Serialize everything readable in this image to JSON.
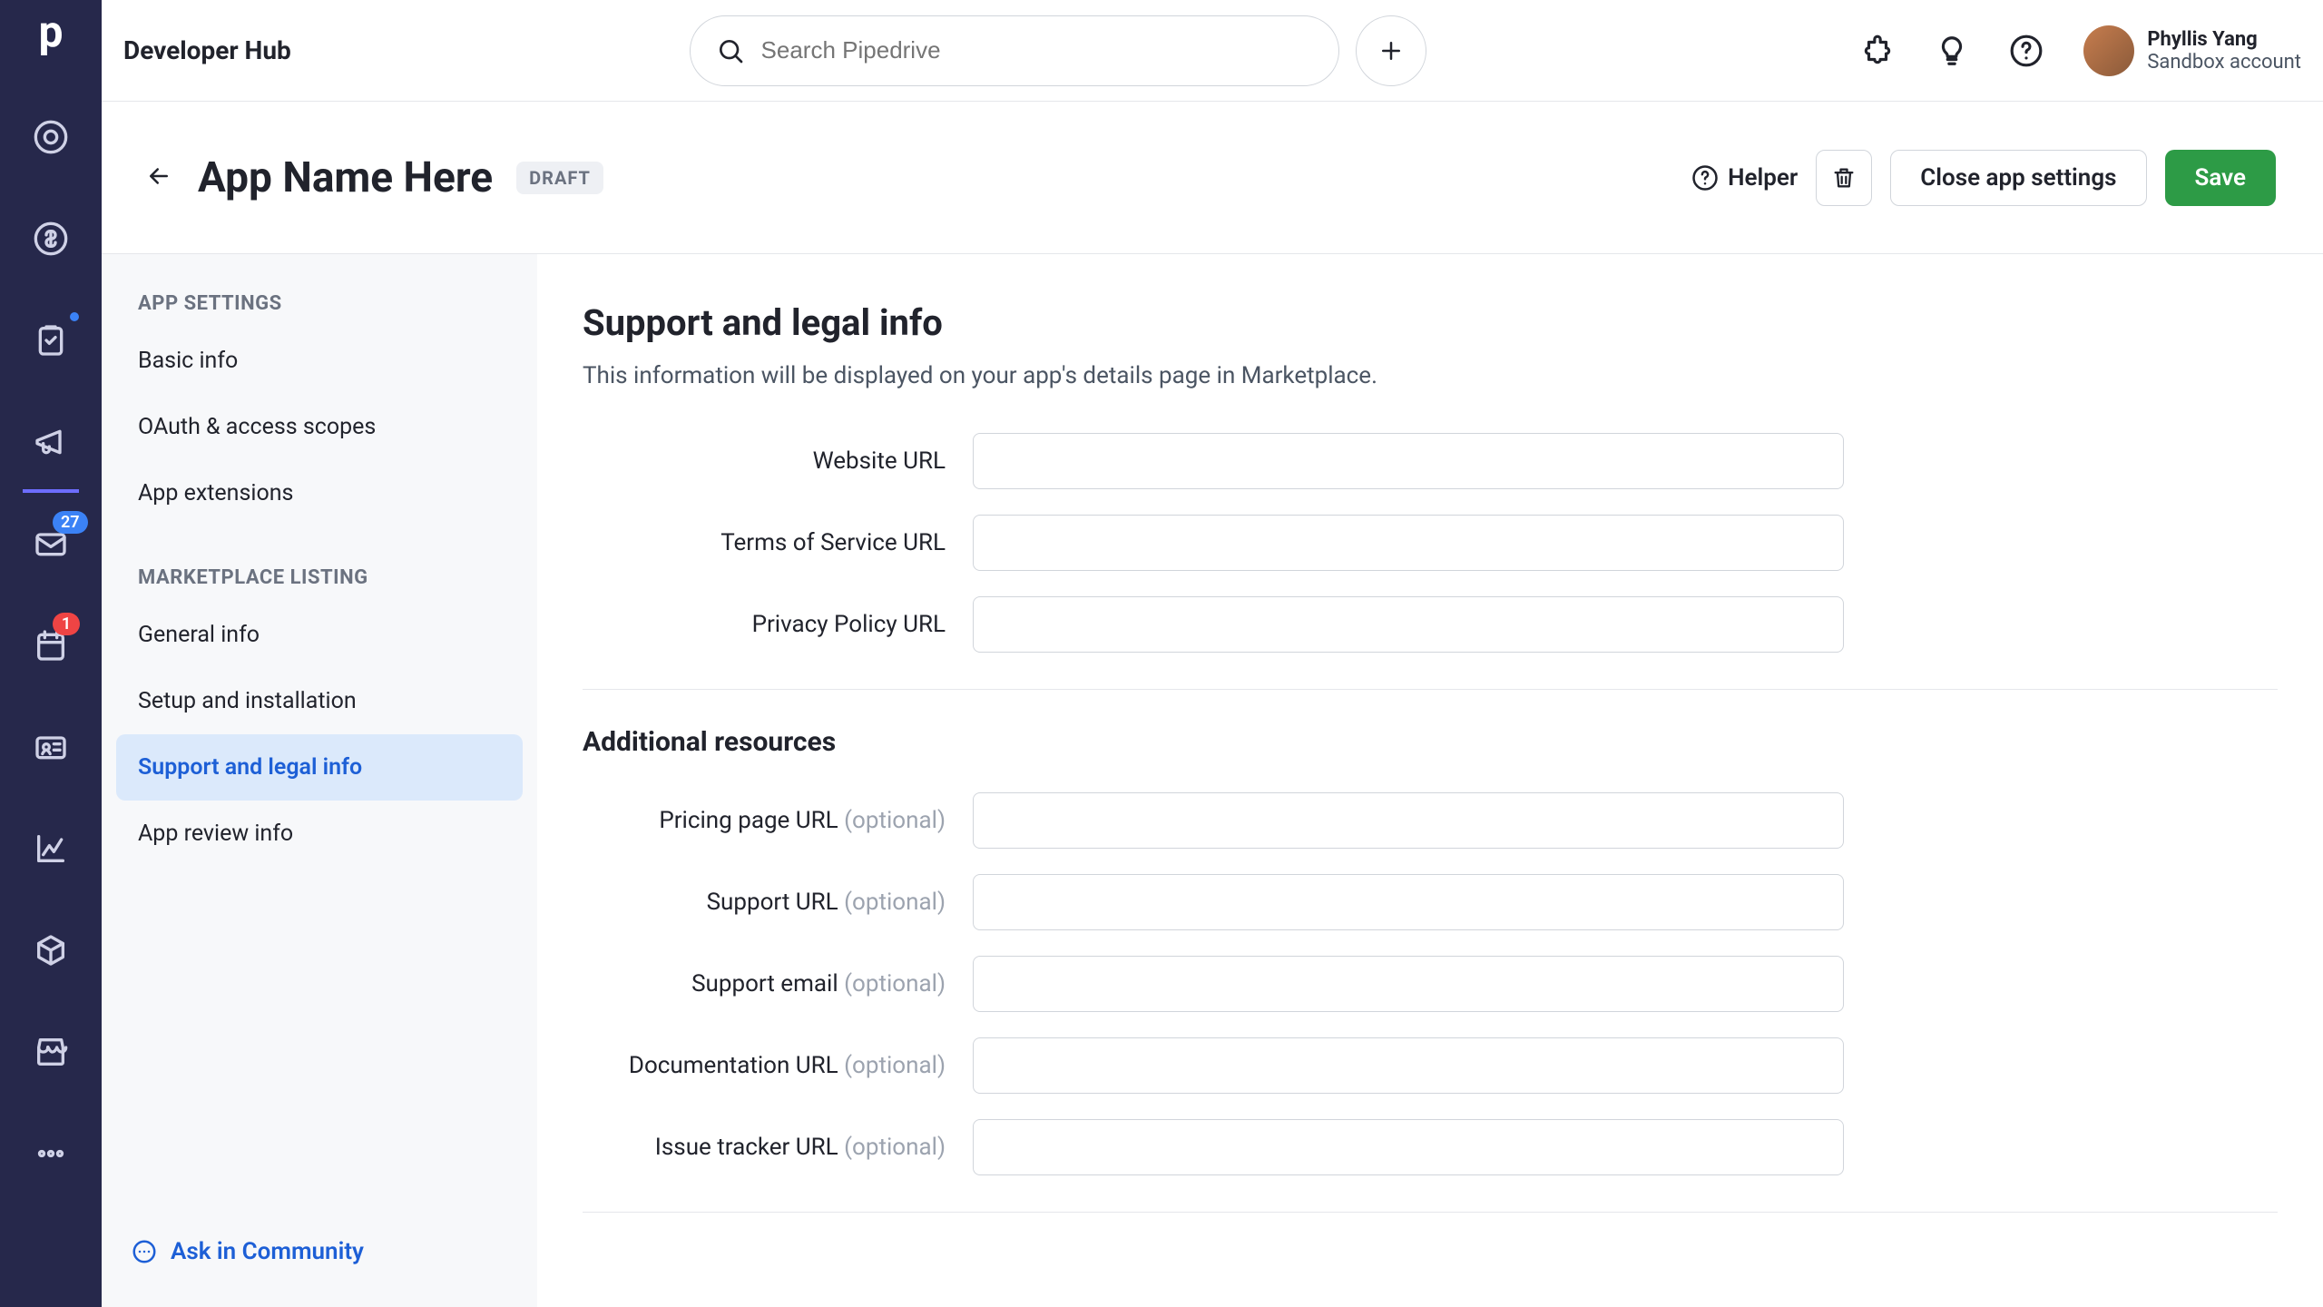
{
  "topbar": {
    "hub_title": "Developer Hub",
    "search_placeholder": "Search Pipedrive",
    "user_name": "Phyllis Yang",
    "account_label": "Sandbox account"
  },
  "nav_rail": {
    "mail_badge": "27",
    "calendar_badge": "1"
  },
  "page_header": {
    "app_title": "App Name Here",
    "status_badge": "DRAFT",
    "helper_label": "Helper",
    "close_label": "Close app settings",
    "save_label": "Save"
  },
  "sidebar": {
    "section_app_settings": "APP SETTINGS",
    "basic_info": "Basic info",
    "oauth": "OAuth & access scopes",
    "extensions": "App extensions",
    "section_marketplace": "MARKETPLACE LISTING",
    "general_info": "General info",
    "setup_install": "Setup and installation",
    "support_legal": "Support and legal info",
    "review_info": "App review info",
    "community_link": "Ask in Community"
  },
  "form": {
    "heading": "Support and legal info",
    "description": "This information will be displayed on your app's details page in Marketplace.",
    "website_label": "Website URL",
    "tos_label": "Terms of Service URL",
    "privacy_label": "Privacy Policy URL",
    "additional_heading": "Additional resources",
    "pricing_label": "Pricing page URL",
    "support_url_label": "Support URL",
    "support_email_label": "Support email",
    "docs_label": "Documentation URL",
    "issue_tracker_label": "Issue tracker URL",
    "optional": "(optional)"
  }
}
